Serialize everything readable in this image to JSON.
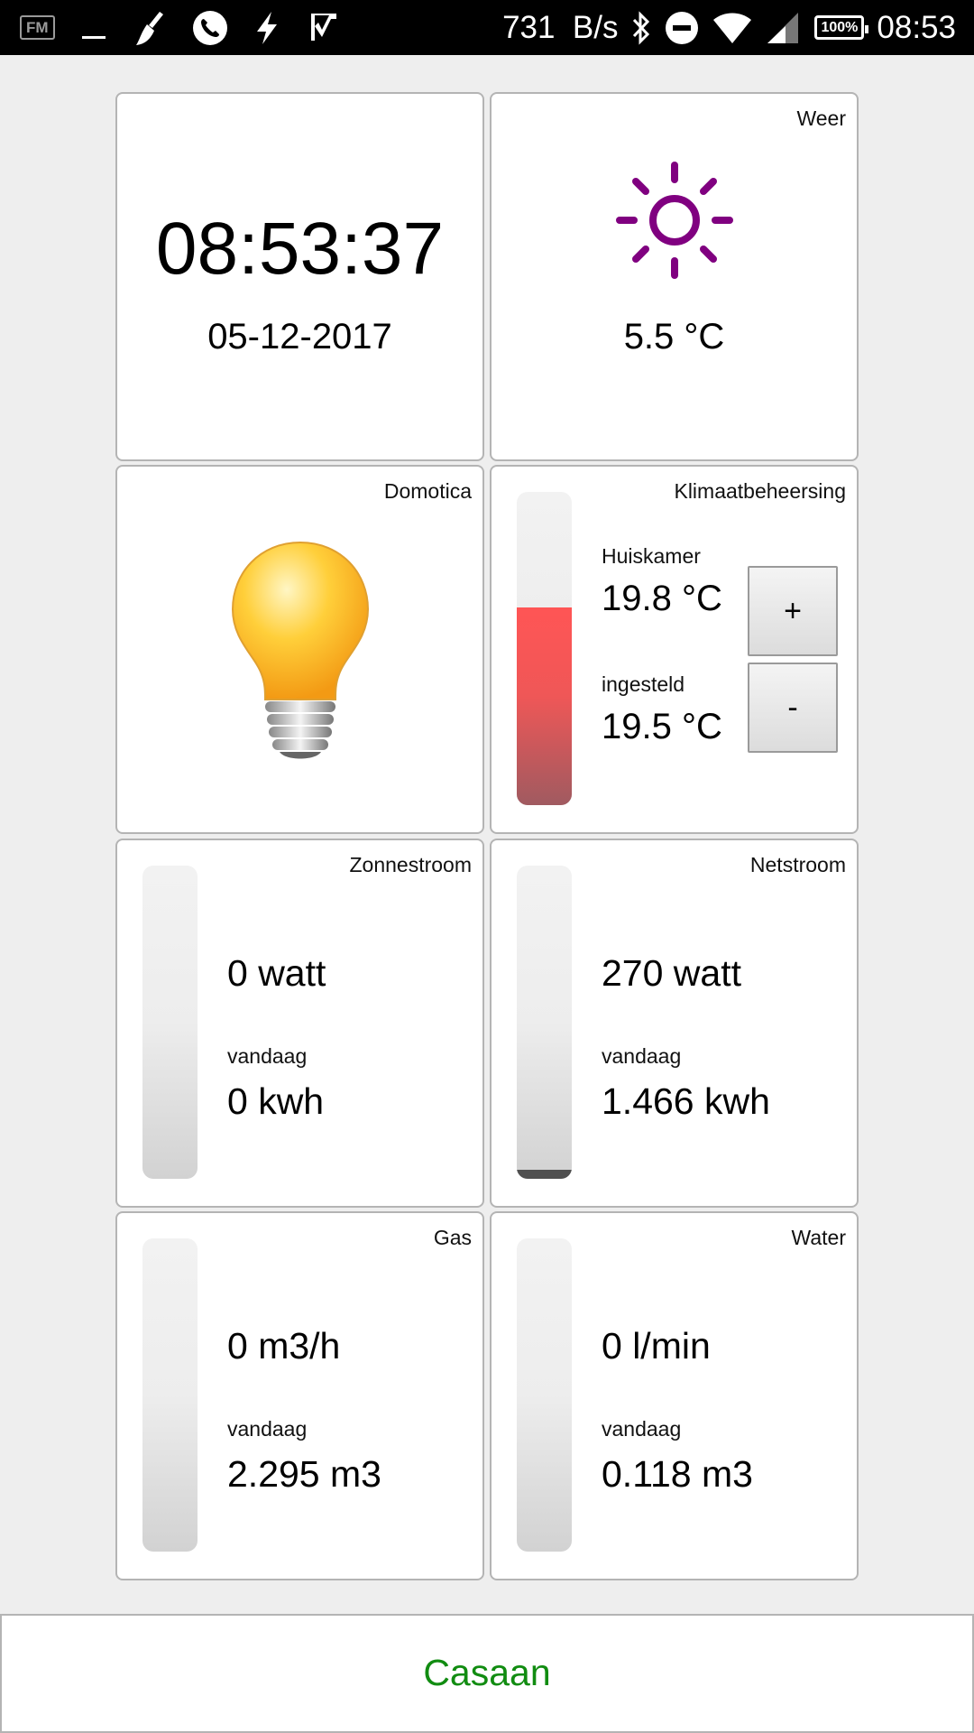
{
  "status_bar": {
    "left_icons": [
      "fm-radio-icon",
      "minimize-icon",
      "broom-icon",
      "phone-icon",
      "flash-icon",
      "checkmark-icon"
    ],
    "fm_label": "FM",
    "network_speed": "731  B/s",
    "battery": "100%",
    "time": "08:53"
  },
  "tiles": {
    "clock": {
      "time": "08:53:37",
      "date": "05-12-2017"
    },
    "weather": {
      "label": "Weer",
      "icon": "sun-icon",
      "icon_color": "#800080",
      "temperature": "5.5 °C"
    },
    "domotica": {
      "label": "Domotica",
      "icon": "light-bulb-icon"
    },
    "climate": {
      "label": "Klimaatbeheersing",
      "room_label": "Huiskamer",
      "room_temp": "19.8 °C",
      "setpoint_label": "ingesteld",
      "setpoint_temp": "19.5 °C",
      "plus_label": "+",
      "minus_label": "-",
      "gauge_level": 0.63
    },
    "solar": {
      "label": "Zonnestroom",
      "current": "0 watt",
      "today_label": "vandaag",
      "today": "0 kwh",
      "gauge_level": 0
    },
    "grid": {
      "label": "Netstroom",
      "current": "270 watt",
      "today_label": "vandaag",
      "today": "1.466 kwh",
      "gauge_level": 0.03
    },
    "gas": {
      "label": "Gas",
      "current": "0 m3/h",
      "today_label": "vandaag",
      "today": "2.295 m3",
      "gauge_level": 0
    },
    "water": {
      "label": "Water",
      "current": "0 l/min",
      "today_label": "vandaag",
      "today": "0.118 m3",
      "gauge_level": 0
    }
  },
  "footer": {
    "title": "Casaan",
    "title_color": "#118c11"
  }
}
